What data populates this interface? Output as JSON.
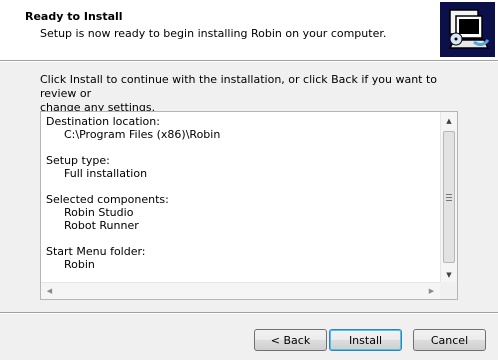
{
  "header": {
    "title": "Ready to Install",
    "subtitle": "Setup is now ready to begin installing Robin on your computer."
  },
  "intro_lines": [
    "Click Install to continue with the installation, or click Back if you want to review or",
    "change any settings."
  ],
  "memo": {
    "destination_label": "Destination location:",
    "destination_value": "C:\\Program Files (x86)\\Robin",
    "setup_type_label": "Setup type:",
    "setup_type_value": "Full installation",
    "components_label": "Selected components:",
    "components": [
      "Robin Studio",
      "Robot Runner"
    ],
    "start_menu_label": "Start Menu folder:",
    "start_menu_value": "Robin"
  },
  "buttons": {
    "back": "< Back",
    "install": "Install",
    "cancel": "Cancel"
  },
  "icons": {
    "logo": "computer-setup-icon",
    "scroll_up": "scroll-up-arrow-icon",
    "scroll_down": "scroll-down-arrow-icon",
    "scroll_left": "scroll-left-arrow-icon",
    "scroll_right": "scroll-right-arrow-icon"
  },
  "colors": {
    "logo_background": "#0b0f4a",
    "default_button_border": "#3c7fb1"
  }
}
